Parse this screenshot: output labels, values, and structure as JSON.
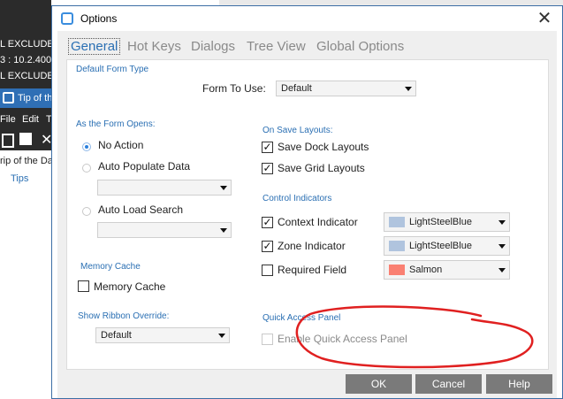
{
  "background_app": {
    "lines": [
      "L EXCLUDE",
      "3 : 10.2.400.",
      "L EXCLUDE"
    ],
    "tab_label": "Tip of th",
    "menu": [
      "File",
      "Edit",
      "T"
    ],
    "tip_text": "rip of the Da",
    "tips_link": "Tips"
  },
  "dialog": {
    "title": "Options",
    "close_glyph": "✕",
    "tabs": [
      "General",
      "Hot Keys",
      "Dialogs",
      "Tree View",
      "Global Options"
    ],
    "active_tab": "General",
    "default_form_type": {
      "section": "Default Form Type",
      "label": "Form To Use:",
      "value": "Default"
    },
    "as_form_opens": {
      "section": "As the Form Opens:",
      "options": [
        "No Action",
        "Auto Populate Data",
        "Auto Load Search"
      ],
      "selected": "No Action",
      "auto_populate_value": "",
      "auto_load_value": ""
    },
    "memory_cache": {
      "section": "Memory Cache",
      "label": "Memory Cache",
      "checked": false
    },
    "ribbon": {
      "section": "Show Ribbon Override:",
      "value": "Default"
    },
    "on_save_layouts": {
      "section": "On Save Layouts:",
      "save_dock": "Save Dock Layouts",
      "save_dock_checked": true,
      "save_grid": "Save Grid Layouts",
      "save_grid_checked": true
    },
    "control_indicators": {
      "section": "Control Indicators",
      "items": [
        {
          "label": "Context Indicator",
          "checked": true,
          "color_name": "LightSteelBlue",
          "color": "#b0c4de"
        },
        {
          "label": "Zone Indicator",
          "checked": true,
          "color_name": "LightSteelBlue",
          "color": "#b0c4de"
        },
        {
          "label": "Required Field",
          "checked": false,
          "color_name": "Salmon",
          "color": "#fa8072"
        }
      ]
    },
    "quick_access": {
      "section": "Quick Access Panel",
      "label": "Enable Quick Access Panel",
      "checked": false,
      "enabled": false
    },
    "buttons": {
      "ok": "OK",
      "cancel": "Cancel",
      "help": "Help"
    }
  },
  "colors": {
    "accent": "#2a6fb3",
    "annotation": "#e02020",
    "button_bg": "#7a7a7a"
  }
}
